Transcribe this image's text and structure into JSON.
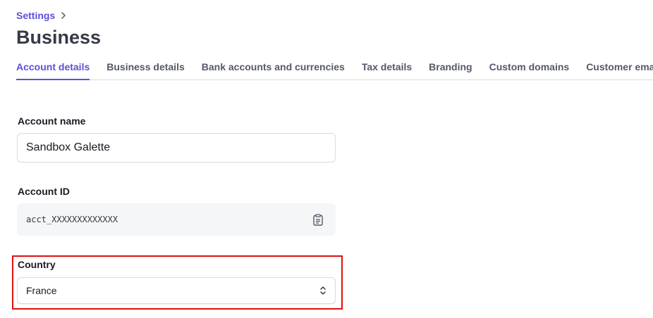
{
  "breadcrumb": {
    "parent": "Settings"
  },
  "page": {
    "title": "Business"
  },
  "tabs": [
    {
      "label": "Account details"
    },
    {
      "label": "Business details"
    },
    {
      "label": "Bank accounts and currencies"
    },
    {
      "label": "Tax details"
    },
    {
      "label": "Branding"
    },
    {
      "label": "Custom domains"
    },
    {
      "label": "Customer emails"
    }
  ],
  "form": {
    "account_name": {
      "label": "Account name",
      "value": "Sandbox Galette"
    },
    "account_id": {
      "label": "Account ID",
      "value": "acct_XXXXXXXXXXXXX",
      "icon": "clipboard-icon"
    },
    "country": {
      "label": "Country",
      "value": "France",
      "icon": "chevron-updown-icon"
    }
  },
  "colors": {
    "accent": "#5b4fd9",
    "highlight": "#e01010",
    "title": "#353a44"
  }
}
